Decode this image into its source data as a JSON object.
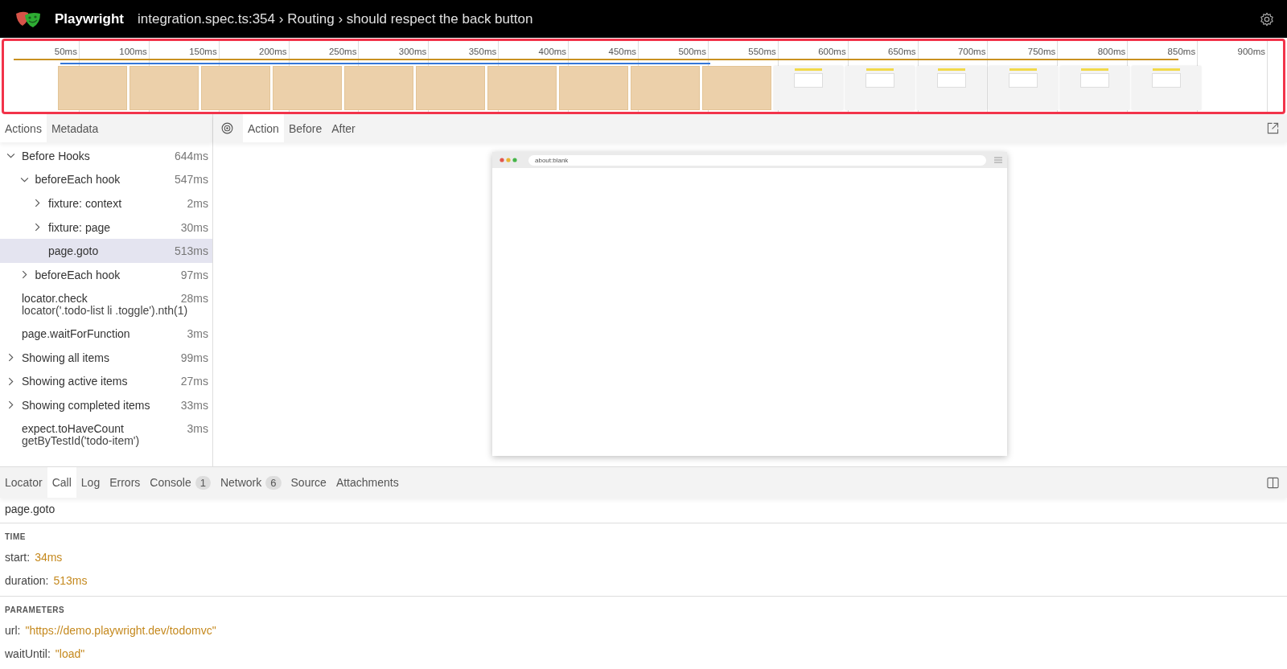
{
  "header": {
    "app_name": "Playwright",
    "title": "integration.spec.ts:354 › Routing › should respect the back button"
  },
  "timeline": {
    "ticks": [
      "50ms",
      "100ms",
      "150ms",
      "200ms",
      "250ms",
      "300ms",
      "350ms",
      "400ms",
      "450ms",
      "500ms",
      "550ms",
      "600ms",
      "650ms",
      "700ms",
      "750ms",
      "800ms",
      "850ms",
      "900ms"
    ],
    "frames": [
      {
        "selected": true
      },
      {
        "selected": true
      },
      {
        "selected": true
      },
      {
        "selected": true
      },
      {
        "selected": true
      },
      {
        "selected": true
      },
      {
        "selected": true
      },
      {
        "selected": true
      },
      {
        "selected": true
      },
      {
        "selected": true
      },
      {
        "selected": false
      },
      {
        "selected": false
      },
      {
        "selected": false
      },
      {
        "selected": false
      },
      {
        "selected": false
      },
      {
        "selected": false
      }
    ]
  },
  "sidebar": {
    "tabs": [
      {
        "label": "Actions",
        "selected": true
      },
      {
        "label": "Metadata",
        "selected": false
      }
    ],
    "actions": [
      {
        "label": "Before Hooks",
        "duration": "644ms",
        "expanded": true,
        "selected": false,
        "children": [
          {
            "label": "beforeEach hook",
            "duration": "547ms",
            "expanded": true,
            "selected": false,
            "children": [
              {
                "label": "fixture: context",
                "duration": "2ms",
                "expanded": false,
                "selected": false
              },
              {
                "label": "fixture: page",
                "duration": "30ms",
                "expanded": false,
                "selected": false
              },
              {
                "label": "page.goto",
                "duration": "513ms",
                "selected": true
              }
            ]
          },
          {
            "label": "beforeEach hook",
            "duration": "97ms",
            "expanded": false,
            "selected": false
          }
        ]
      },
      {
        "label": "locator.check",
        "sublabel": "locator('.todo-list li .toggle').nth(1)",
        "duration": "28ms",
        "selected": false
      },
      {
        "label": "page.waitForFunction",
        "duration": "3ms",
        "selected": false
      },
      {
        "label": "Showing all items",
        "duration": "99ms",
        "expanded": false,
        "selected": false
      },
      {
        "label": "Showing active items",
        "duration": "27ms",
        "expanded": false,
        "selected": false
      },
      {
        "label": "Showing completed items",
        "duration": "33ms",
        "expanded": false,
        "selected": false
      },
      {
        "label": "expect.toHaveCount",
        "sublabel": "getByTestId('todo-item')",
        "duration": "3ms",
        "selected": false
      }
    ]
  },
  "snapshot": {
    "tabs": [
      {
        "label": "Action",
        "selected": true
      },
      {
        "label": "Before",
        "selected": false
      },
      {
        "label": "After",
        "selected": false
      }
    ],
    "browser": {
      "url": "about:blank"
    }
  },
  "details": {
    "tabs": [
      {
        "label": "Locator",
        "selected": false
      },
      {
        "label": "Call",
        "selected": true
      },
      {
        "label": "Log",
        "selected": false
      },
      {
        "label": "Errors",
        "selected": false
      },
      {
        "label": "Console",
        "count": "1",
        "selected": false
      },
      {
        "label": "Network",
        "count": "6",
        "selected": false
      },
      {
        "label": "Source",
        "selected": false
      },
      {
        "label": "Attachments",
        "selected": false
      }
    ],
    "call_title": "page.goto",
    "sections": [
      {
        "heading": "TIME",
        "params": [
          {
            "name": "start:",
            "value": "34ms"
          },
          {
            "name": "duration:",
            "value": "513ms"
          }
        ]
      },
      {
        "heading": "PARAMETERS",
        "params": [
          {
            "name": "url:",
            "value": "\"https://demo.playwright.dev/todomvc\""
          },
          {
            "name": "waitUntil:",
            "value": "\"load\""
          }
        ]
      }
    ]
  }
}
